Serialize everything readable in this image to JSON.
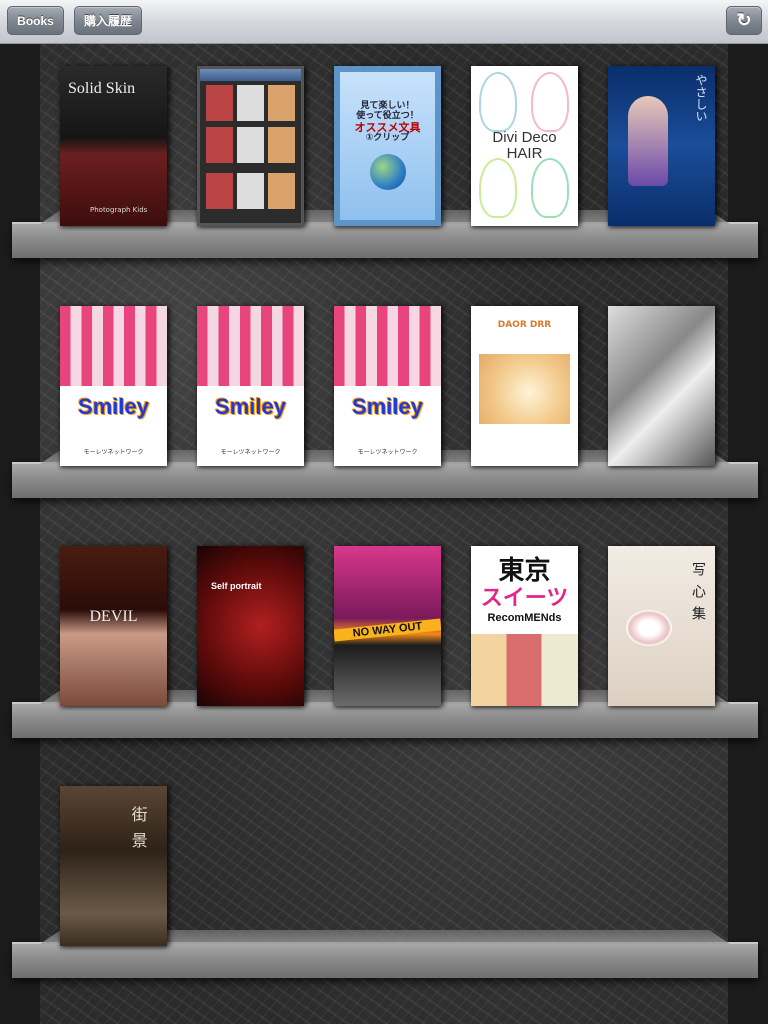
{
  "toolbar": {
    "books_label": "Books",
    "history_label": "購入履歴",
    "refresh_icon": "refresh-icon"
  },
  "colors": {
    "toolbar_top": "#f4f5f7",
    "toolbar_bottom": "#c2c6cc",
    "button": "#7d848e",
    "shelf": "#8d8d8d",
    "background": "#2b2b2b"
  },
  "books": {
    "solid_skin": {
      "title": "Solid Skin",
      "subtitle": "Photograph Kids"
    },
    "bookshelf_app": {
      "title": ""
    },
    "bunbougu": {
      "line1": "見て楽しい！",
      "line2": "使って役立つ！",
      "line3": "オススメ文具",
      "line4": "①クリップ"
    },
    "divi_deco": {
      "title": "Divi Deco",
      "subtitle": "HAIR"
    },
    "yoake": {
      "title": "やさしい"
    },
    "smiley_1": {
      "logo": "Smiley",
      "sub": "モーレツネットワーク"
    },
    "smiley_2": {
      "logo": "Smiley",
      "sub": "モーレツネットワーク"
    },
    "smiley_3": {
      "logo": "Smiley",
      "sub": "モーレツネットワーク"
    },
    "dog_book": {
      "header": "DAOR DRR"
    },
    "collage": {
      "title": ""
    },
    "devil": {
      "title": "DEVIL"
    },
    "self_portrait": {
      "title": "Self portrait"
    },
    "no_way_out": {
      "title": "NO WAY OUT"
    },
    "tokyo_sweets": {
      "line1": "東京",
      "line2": "スイーツ",
      "line3": "RecomMENds"
    },
    "shashin": {
      "title": "写心集"
    },
    "tokei": {
      "title": "街景"
    }
  }
}
